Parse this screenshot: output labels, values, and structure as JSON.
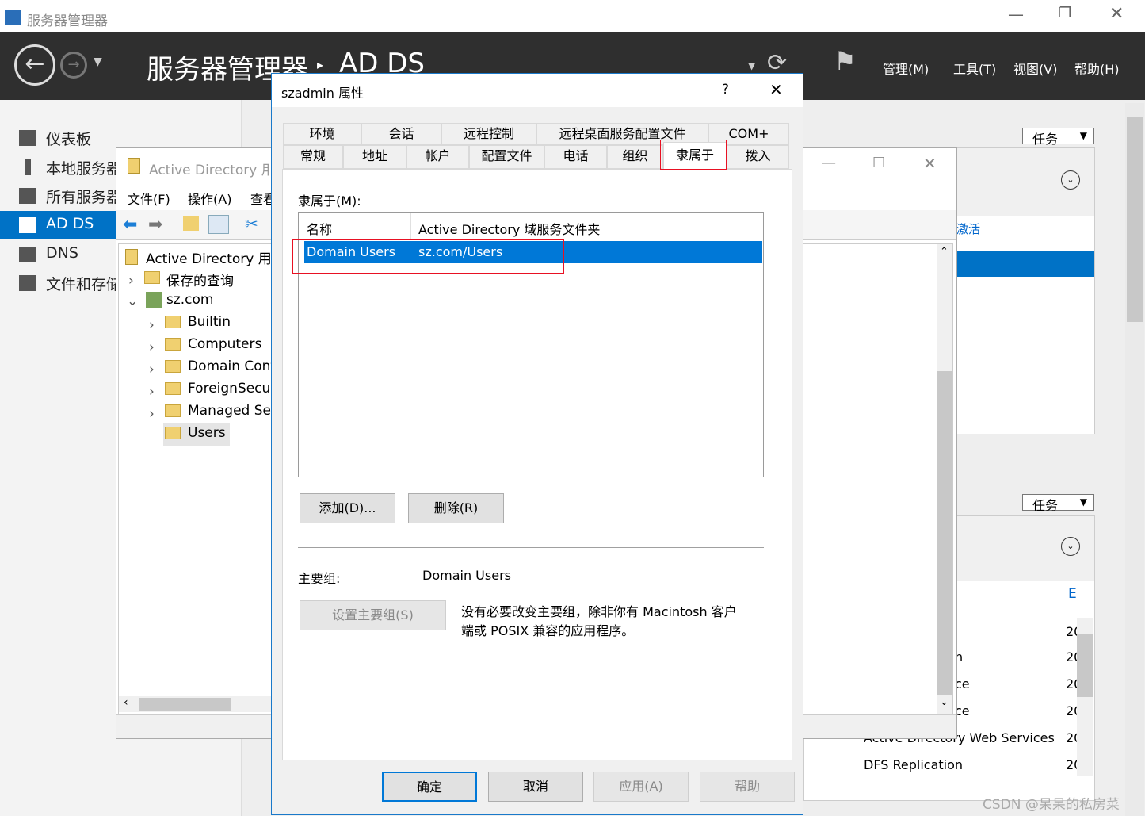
{
  "app": {
    "title": "服务器管理器",
    "breadcrumb_root": "服务器管理器",
    "breadcrumb_sep": "▸",
    "breadcrumb_current": "AD DS",
    "menus": [
      "管理(M)",
      "工具(T)",
      "视图(V)",
      "帮助(H)"
    ]
  },
  "sidebar": {
    "items": [
      {
        "label": "仪表板",
        "icon": "dashboard-icon"
      },
      {
        "label": "本地服务器",
        "icon": "local-server-icon"
      },
      {
        "label": "所有服务器",
        "icon": "all-servers-icon"
      },
      {
        "label": "AD DS",
        "icon": "ad-ds-icon",
        "selected": true
      },
      {
        "label": "DNS",
        "icon": "dns-icon"
      },
      {
        "label": "文件和存储服务",
        "icon": "file-storage-icon"
      }
    ]
  },
  "background": {
    "tasks_label": "任务",
    "tab_partial": "激活",
    "col_partial": "E",
    "date_partial": "20",
    "services": [
      "n",
      "ce",
      "ce",
      "Active Directory Web Services",
      "DFS Replication"
    ]
  },
  "aduc": {
    "title": "Active Directory 用户和计算机",
    "menus": [
      "文件(F)",
      "操作(A)",
      "查看"
    ],
    "tree": {
      "root": "Active Directory 用户和计算机",
      "saved": "保存的查询",
      "domain": "sz.com",
      "children": [
        "Builtin",
        "Computers",
        "Domain Controllers",
        "ForeignSecurityPrincipals",
        "Managed Service Accounts",
        "Users"
      ],
      "selected": "Users"
    }
  },
  "dialog": {
    "title": "szadmin 属性",
    "help": "?",
    "close": "✕",
    "tabs_row1": [
      "环境",
      "会话",
      "远程控制",
      "远程桌面服务配置文件",
      "COM+"
    ],
    "tabs_row2": [
      "常规",
      "地址",
      "帐户",
      "配置文件",
      "电话",
      "组织",
      "隶属于",
      "拨入"
    ],
    "active_tab": "隶属于",
    "member_of_label": "隶属于(M):",
    "columns": [
      "名称",
      "Active Directory 域服务文件夹"
    ],
    "rows": [
      {
        "name": "Domain Users",
        "folder": "sz.com/Users",
        "selected": true
      }
    ],
    "add_button": "添加(D)...",
    "remove_button": "删除(R)",
    "primary_group_label": "主要组:",
    "primary_group_value": "Domain Users",
    "set_primary_button": "设置主要组(S)",
    "note_line1": "没有必要改变主要组，除非你有 Macintosh 客户",
    "note_line2": "端或 POSIX 兼容的应用程序。",
    "ok": "确定",
    "cancel": "取消",
    "apply": "应用(A)",
    "helpbtn": "帮助",
    "highlight_color": "#e81123",
    "selection_color": "#0078d7"
  },
  "watermark": "CSDN @呆呆的私房菜"
}
